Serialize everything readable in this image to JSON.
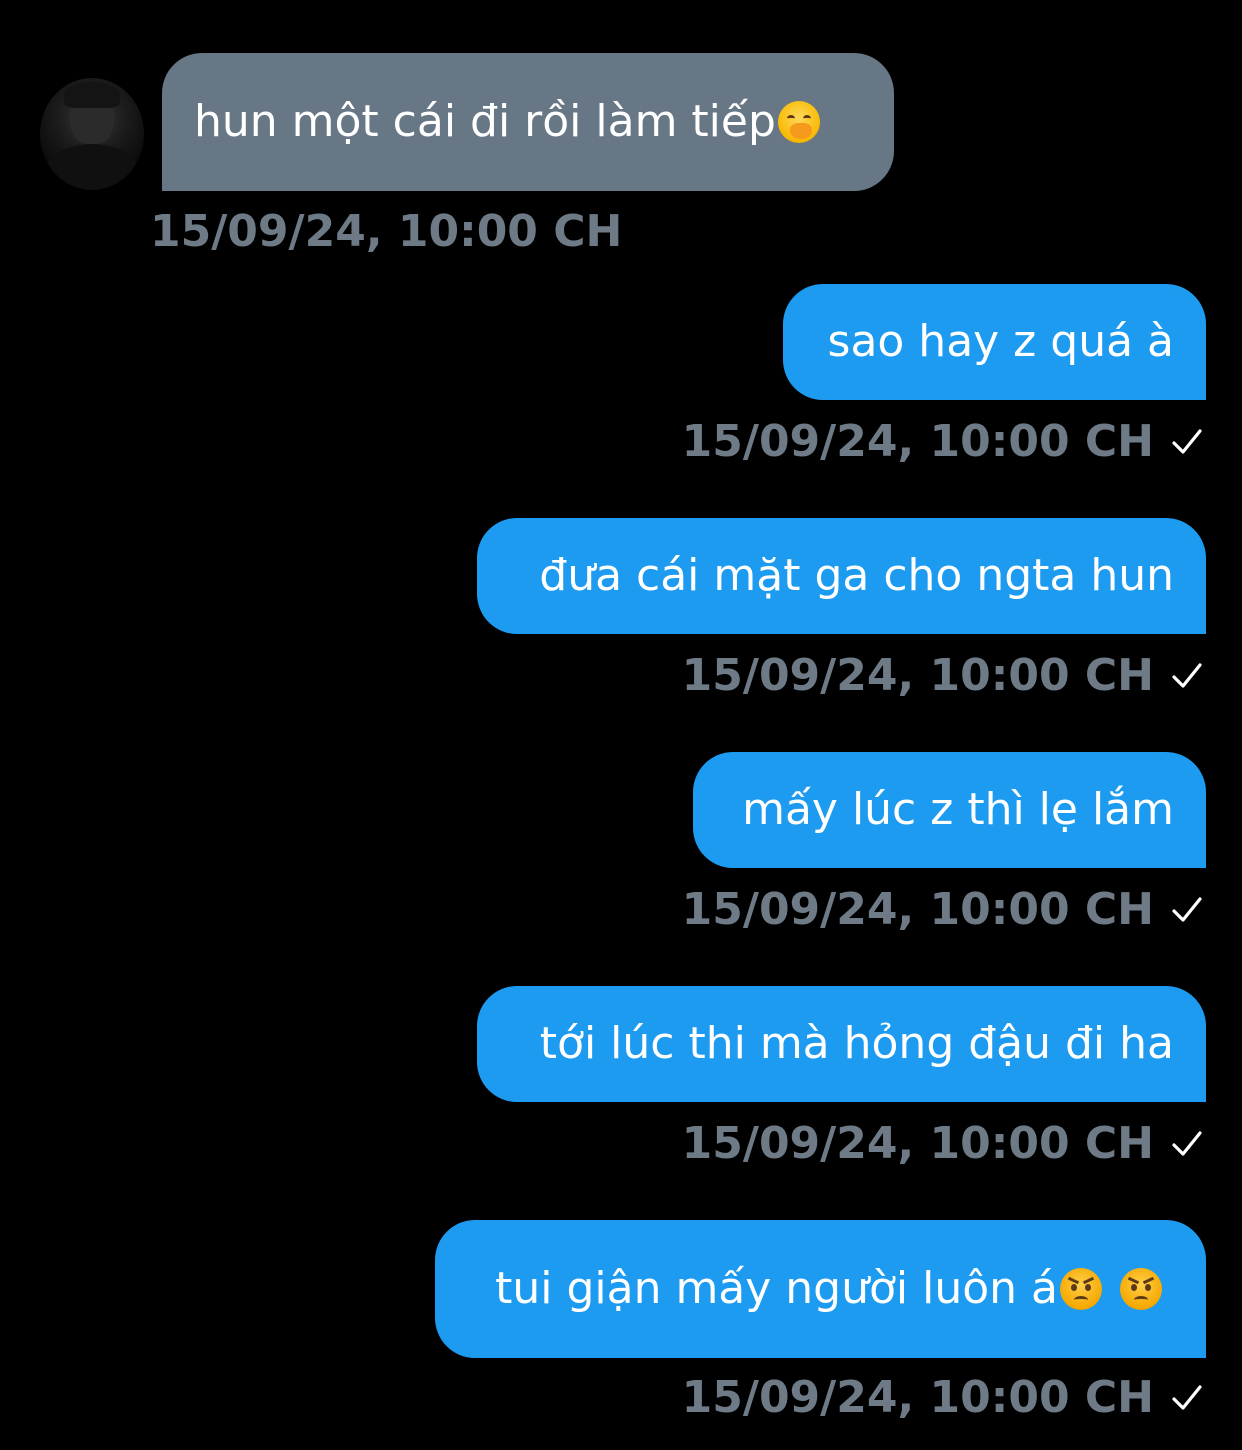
{
  "messages": [
    {
      "direction": "incoming",
      "text": "hun một cái đi rồi làm tiếp",
      "emojis": [
        "face-with-hand-over-mouth"
      ],
      "timestamp": "15/09/24, 10:00 CH"
    },
    {
      "direction": "outgoing",
      "text": "sao hay z quá à",
      "emojis": [],
      "timestamp": "15/09/24, 10:00 CH",
      "status_icon": "check-icon"
    },
    {
      "direction": "outgoing",
      "text": "đưa cái mặt ga cho ngta hun",
      "emojis": [],
      "timestamp": "15/09/24, 10:00 CH",
      "status_icon": "check-icon"
    },
    {
      "direction": "outgoing",
      "text": "mấy lúc z thì lẹ lắm",
      "emojis": [],
      "timestamp": "15/09/24, 10:00 CH",
      "status_icon": "check-icon"
    },
    {
      "direction": "outgoing",
      "text": "tới lúc thi mà hỏng đậu đi ha",
      "emojis": [],
      "timestamp": "15/09/24, 10:00 CH",
      "status_icon": "check-icon"
    },
    {
      "direction": "outgoing",
      "text": "tui giận mấy người luôn á",
      "emojis": [
        "angry-face",
        "angry-face"
      ],
      "timestamp": "15/09/24, 10:00 CH",
      "status_icon": "check-icon"
    }
  ],
  "colors": {
    "background": "#000000",
    "incoming_bubble": "#687785",
    "outgoing_bubble": "#1d9bf0",
    "message_text": "#ffffff",
    "timestamp_text": "#6e7b87",
    "check_mark": "#ffffff"
  }
}
